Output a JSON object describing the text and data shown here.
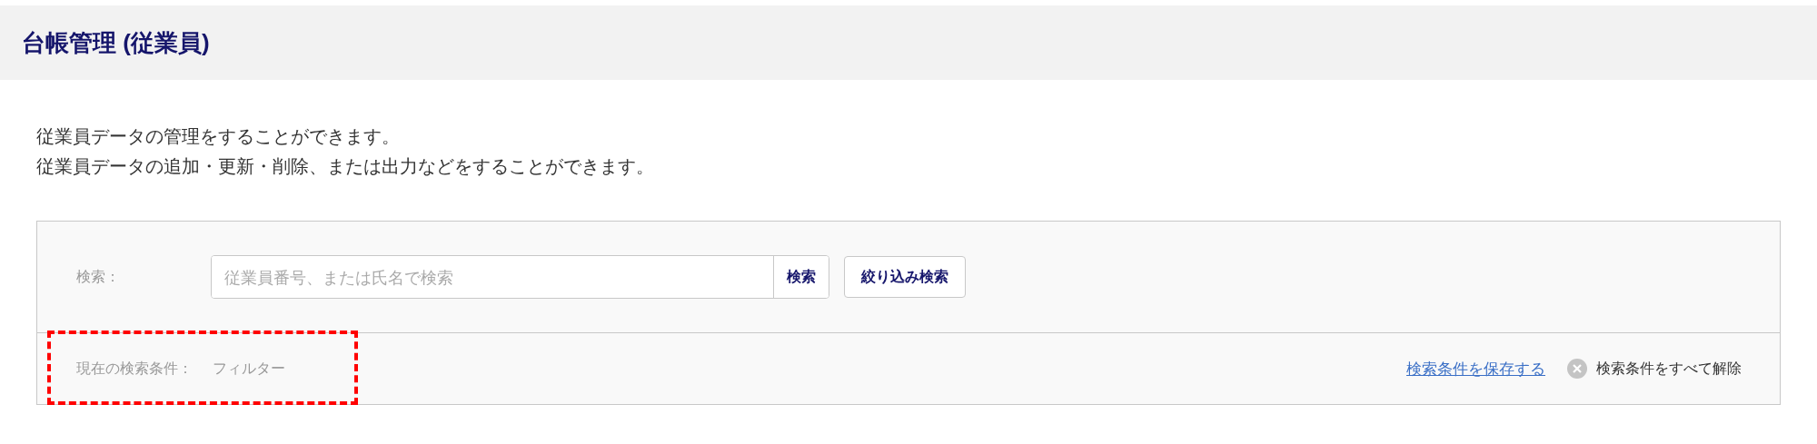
{
  "header": {
    "title": "台帳管理 (従業員)"
  },
  "description": [
    "従業員データの管理をすることができます。",
    "従業員データの追加・更新・削除、または出力などをすることができます。"
  ],
  "search": {
    "label": "検索：",
    "placeholder": "従業員番号、または氏名で検索",
    "button": "検索",
    "filter_button": "絞り込み検索"
  },
  "conditions": {
    "label": "現在の検索条件：",
    "value": "フィルター",
    "save_link": "検索条件を保存する",
    "clear_all": "検索条件をすべて解除"
  }
}
